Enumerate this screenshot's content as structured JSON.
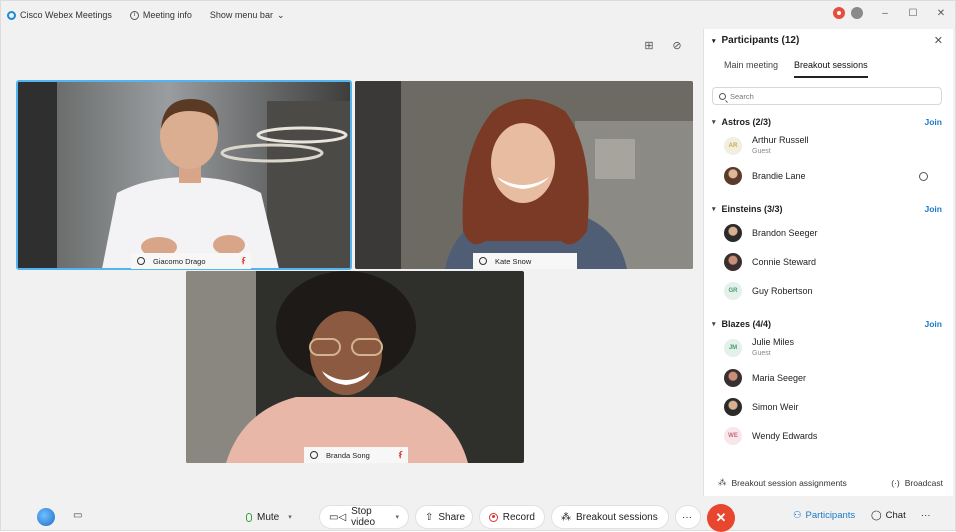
{
  "titlebar": {
    "app_name": "Cisco Webex Meetings",
    "meeting_info": "Meeting info",
    "show_menu_bar": "Show menu bar"
  },
  "videos": [
    {
      "name": "Giacomo Drago",
      "muted": true
    },
    {
      "name": "Kate Snow",
      "muted": false
    },
    {
      "name": "Branda Song",
      "muted": true
    }
  ],
  "panel": {
    "title": "Participants (12)",
    "tabs": [
      {
        "label": "Main meeting",
        "active": false
      },
      {
        "label": "Breakout sessions",
        "active": true
      }
    ],
    "search_placeholder": "Search",
    "groups": [
      {
        "name": "Astros (2/3)",
        "join": "Join",
        "members": [
          {
            "name": "Arthur Russell",
            "sub": "Guest",
            "avatar": "AR"
          },
          {
            "name": "Brandie Lane",
            "sub": "",
            "avatar": "photo"
          }
        ]
      },
      {
        "name": "Einsteins (3/3)",
        "join": "Join",
        "members": [
          {
            "name": "Brandon Seeger",
            "sub": "",
            "avatar": "photo"
          },
          {
            "name": "Connie Steward",
            "sub": "",
            "avatar": "photo"
          },
          {
            "name": "Guy Robertson",
            "sub": "",
            "avatar": "GR"
          }
        ]
      },
      {
        "name": "Blazes (4/4)",
        "join": "Join",
        "members": [
          {
            "name": "Julie Miles",
            "sub": "Guest",
            "avatar": "JM"
          },
          {
            "name": "Maria Seeger",
            "sub": "",
            "avatar": "photo"
          },
          {
            "name": "Simon Weir",
            "sub": "",
            "avatar": "photo"
          },
          {
            "name": "Wendy Edwards",
            "sub": "",
            "avatar": "WE"
          }
        ]
      }
    ],
    "footer": {
      "assignments": "Breakout session assignments",
      "broadcast": "Broadcast"
    }
  },
  "toolbar": {
    "mute": "Mute",
    "stop_video": "Stop video",
    "share": "Share",
    "record": "Record",
    "breakout_sessions": "Breakout sessions",
    "more": "···",
    "end": "✕",
    "participants": "Participants",
    "chat": "Chat",
    "more_right": "···"
  },
  "colors": {
    "accent": "#1a79c8",
    "end_call": "#e8462e",
    "active_speaker": "#54b4f0",
    "muted": "#d9412e"
  }
}
